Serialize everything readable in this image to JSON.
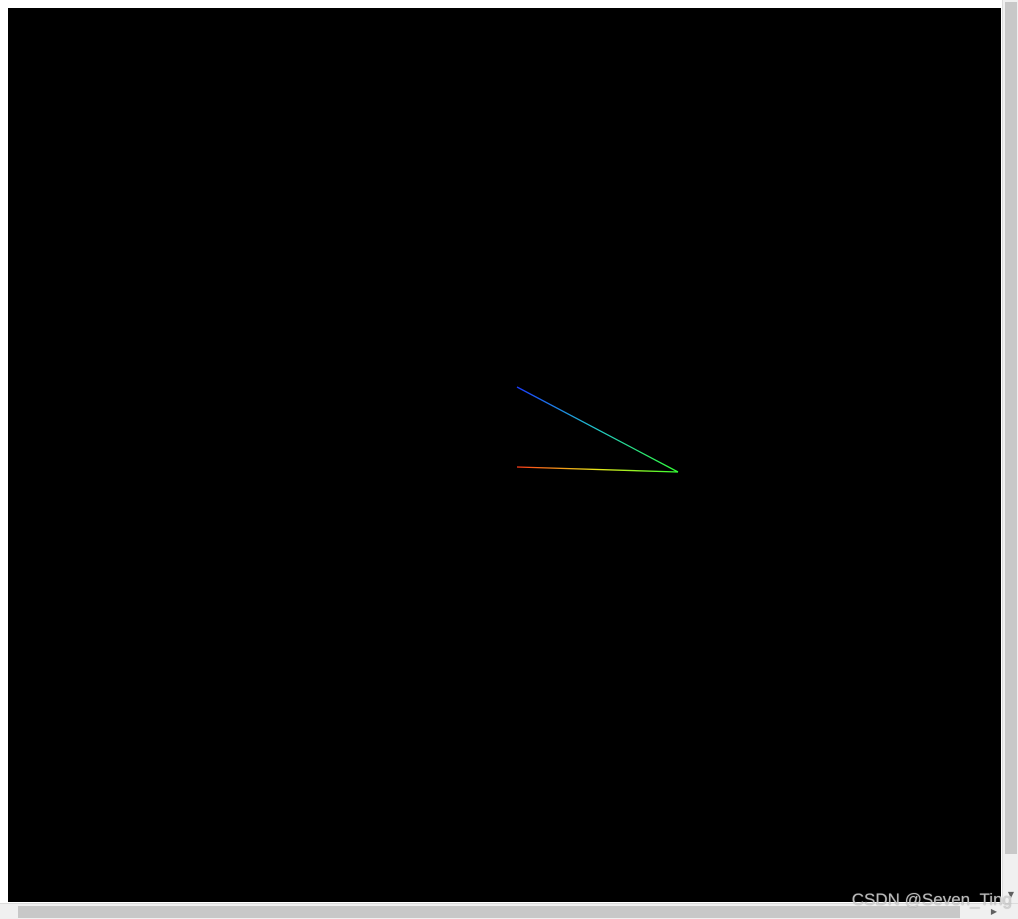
{
  "scene": {
    "background_color": "#000000",
    "polyline": {
      "description_colors": [
        "#0000ff",
        "#00ff00",
        "#ff0000"
      ],
      "vertices": [
        {
          "name": "blue-end",
          "color": "#1a3cff"
        },
        {
          "name": "green-vertex",
          "color": "#33ff33"
        },
        {
          "name": "red-end",
          "color": "#ff3b1a"
        }
      ]
    }
  },
  "watermark": {
    "text": "CSDN @Seven_Ting"
  },
  "scrollbars": {
    "vertical_arrow": "▼",
    "horizontal_arrow": "▶"
  }
}
